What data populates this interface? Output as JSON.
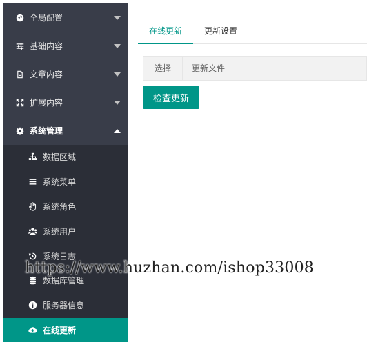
{
  "sidebar": {
    "menus": [
      {
        "label": "全局配置",
        "icon": "globe-icon"
      },
      {
        "label": "基础内容",
        "icon": "sliders-icon"
      },
      {
        "label": "文章内容",
        "icon": "document-icon"
      },
      {
        "label": "扩展内容",
        "icon": "expand-icon"
      },
      {
        "label": "系统管理",
        "icon": "gear-icon"
      }
    ],
    "submenu": [
      {
        "label": "数据区域",
        "icon": "sitemap-icon"
      },
      {
        "label": "系统菜单",
        "icon": "list-icon"
      },
      {
        "label": "系统角色",
        "icon": "hand-icon"
      },
      {
        "label": "系统用户",
        "icon": "users-icon"
      },
      {
        "label": "系统日志",
        "icon": "history-icon"
      },
      {
        "label": "数据库管理",
        "icon": "database-icon"
      },
      {
        "label": "服务器信息",
        "icon": "info-icon"
      },
      {
        "label": "在线更新",
        "icon": "cloud-upload-icon"
      }
    ]
  },
  "main": {
    "tabs": [
      {
        "label": "在线更新"
      },
      {
        "label": "更新设置"
      }
    ],
    "table": {
      "headers": [
        "选择",
        "更新文件"
      ]
    },
    "check_button": "检查更新"
  },
  "watermark": "https://www.huzhan.com/ishop33008",
  "colors": {
    "accent": "#009688",
    "sidebar": "#393d49",
    "submenu": "#2b2e37"
  }
}
